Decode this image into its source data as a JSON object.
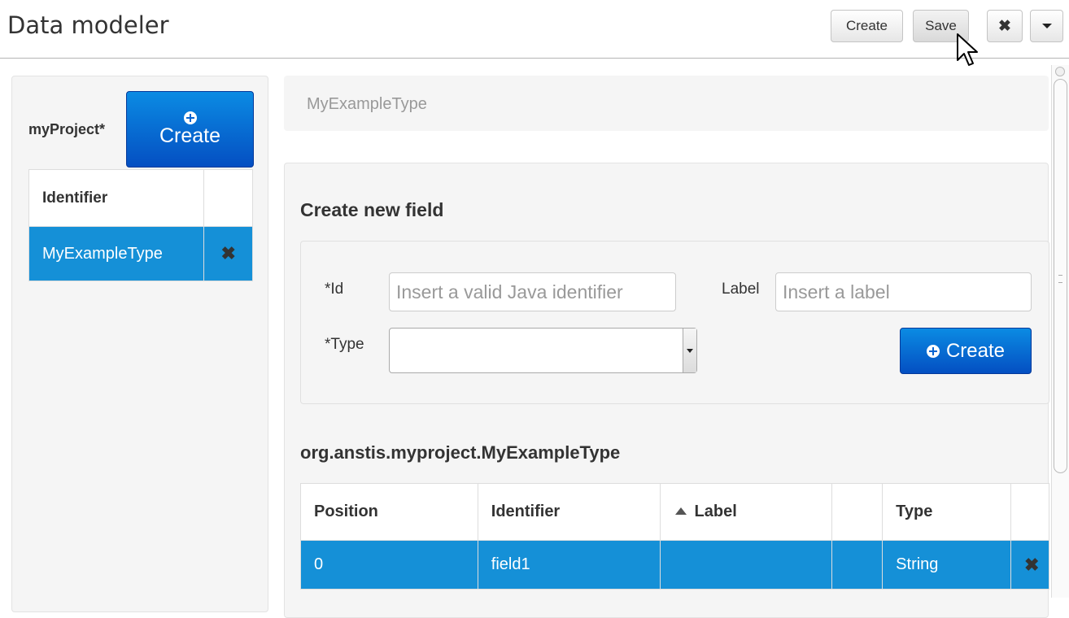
{
  "app": {
    "title": "Data modeler"
  },
  "toolbar": {
    "create_label": "Create",
    "save_label": "Save",
    "close_icon": "✖"
  },
  "project": {
    "name": "myProject*",
    "create_label": "Create",
    "table": {
      "header": "Identifier",
      "rows": [
        {
          "identifier": "MyExampleType",
          "delete_icon": "✖"
        }
      ]
    }
  },
  "type_header": {
    "name": "MyExampleType"
  },
  "new_field": {
    "title": "Create new field",
    "id_label": "*Id",
    "id_placeholder": "Insert a valid Java identifier",
    "label_label": "Label",
    "label_placeholder": "Insert a label",
    "type_label": "*Type",
    "type_value": "",
    "create_label": "Create"
  },
  "fields": {
    "title": "org.anstis.myproject.MyExampleType",
    "columns": {
      "position": "Position",
      "identifier": "Identifier",
      "label": "Label",
      "type": "Type"
    },
    "rows": [
      {
        "position": "0",
        "identifier": "field1",
        "label": "",
        "type": "String",
        "delete_icon": "✖"
      }
    ]
  },
  "colors": {
    "primary": "#0b6fd8",
    "selected_row": "#1590d7"
  }
}
